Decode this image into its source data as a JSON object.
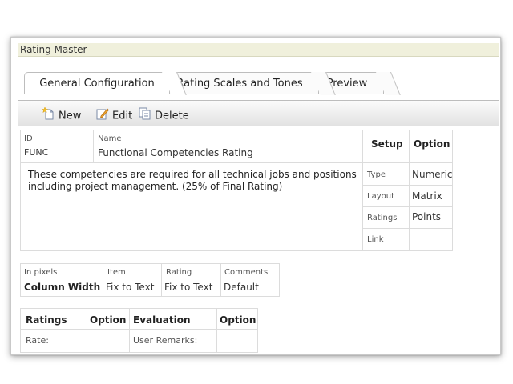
{
  "window": {
    "title": "Rating Master"
  },
  "tabs": [
    {
      "label": "General Configuration"
    },
    {
      "label": "Rating Scales and Tones"
    },
    {
      "label": "Preview"
    }
  ],
  "toolbar": {
    "new_label": "New",
    "edit_label": "Edit",
    "delete_label": "Delete"
  },
  "record": {
    "id_label": "ID",
    "id_value": "FUNC",
    "name_label": "Name",
    "name_value": "Functional Competencies Rating",
    "description": "These competencies are required for all technical jobs and positions including project management. (25% of Final Rating)"
  },
  "setup": {
    "header_setup": "Setup",
    "header_option": "Option",
    "rows": [
      {
        "setup": "Type",
        "option": "Numeric"
      },
      {
        "setup": "Layout",
        "option": "Matrix"
      },
      {
        "setup": "Ratings",
        "option": "Points"
      },
      {
        "setup": "Link",
        "option": ""
      }
    ]
  },
  "column_width": {
    "unit_label": "In pixels",
    "row_label": "Column Width",
    "headers": [
      "Item",
      "Rating",
      "Comments"
    ],
    "values": [
      "Fix to Text",
      "Fix to Text",
      "Default"
    ]
  },
  "ratings_table": {
    "headers": [
      "Ratings",
      "Option",
      "Evaluation",
      "Option"
    ],
    "row": [
      "Rate:",
      "",
      "User Remarks:",
      ""
    ]
  },
  "icons": {
    "new": "new-document-icon",
    "edit": "edit-pencil-icon",
    "delete": "delete-copy-icon"
  }
}
